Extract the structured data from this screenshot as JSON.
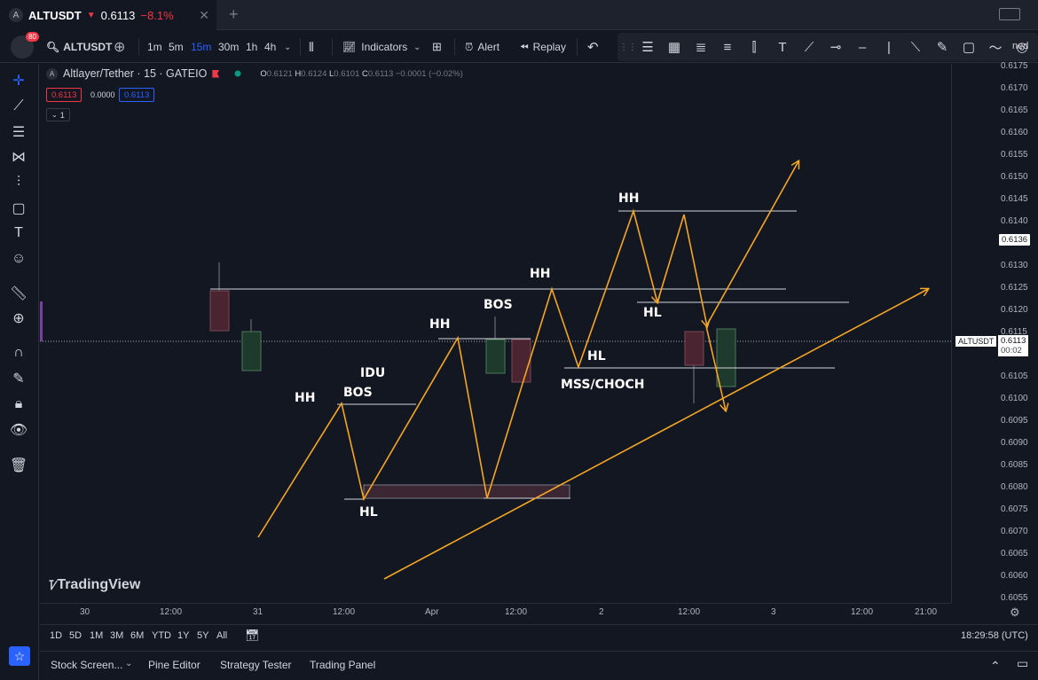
{
  "tab": {
    "avatar": "A",
    "symbol": "ALTUSDT",
    "arrow": "▼",
    "price": "0.6113",
    "change": "−8.1%",
    "close_icon": "close-icon"
  },
  "toolbar": {
    "avatar_badge": "80",
    "symbol": "ALTUSDT",
    "intervals": [
      "1m",
      "5m",
      "15m",
      "30m",
      "1h",
      "4h"
    ],
    "active_interval": "15m",
    "indicators_label": "Indicators",
    "alert_label": "Alert",
    "replay_label": "Replay",
    "truncated_label": "ned"
  },
  "legend": {
    "title": "Altlayer/Tether · 15 · GATEIO",
    "open_label": "O",
    "open": "0.6121",
    "high_label": "H",
    "high": "0.6124",
    "low_label": "L",
    "low": "0.6101",
    "close_label": "C",
    "close": "0.6113",
    "change": "−0.0001 (−0.02%)",
    "bid": "0.6113",
    "spread": "0.0000",
    "ask": "0.6113",
    "indicators_count": "1"
  },
  "price_axis": {
    "ticks": [
      "0.6175",
      "0.6170",
      "0.6165",
      "0.6160",
      "0.6155",
      "0.6150",
      "0.6145",
      "0.6140",
      "0.6135",
      "0.6130",
      "0.6125",
      "0.6120",
      "0.6115",
      "0.6110",
      "0.6105",
      "0.6100",
      "0.6095",
      "0.6090",
      "0.6085",
      "0.6080",
      "0.6075",
      "0.6070",
      "0.6065",
      "0.6060",
      "0.6055"
    ],
    "drawing_label": "0.6136",
    "symbol_label": "ALTUSDT",
    "current_price": "0.6113",
    "countdown": "00:02"
  },
  "time_axis": {
    "ticks": [
      "30",
      "12:00",
      "31",
      "12:00",
      "Apr",
      "12:00",
      "2",
      "12:00",
      "3",
      "12:00",
      "21:00"
    ]
  },
  "annotations": {
    "hh1": "HH",
    "bos1": "BOS",
    "idu": "IDU",
    "hl1": "HL",
    "hh2": "HH",
    "bos2": "BOS",
    "hh3": "HH",
    "hl2": "HL",
    "mss": "MSS/CHOCH",
    "hh4": "HH",
    "hl3": "HL"
  },
  "watermark": "TradingView",
  "range_buttons": [
    "1D",
    "5D",
    "1M",
    "3M",
    "6M",
    "YTD",
    "1Y",
    "5Y",
    "All"
  ],
  "clock": "18:29:58 (UTC)",
  "panels": [
    "Stock Screen...",
    "Pine Editor",
    "Strategy Tester",
    "Trading Panel"
  ],
  "colors": {
    "background": "#131722",
    "drawing_orange": "#f5a623",
    "bull_candle": "#1e3a2d",
    "bear_candle": "#4a2430",
    "accent_blue": "#2962ff",
    "down_red": "#f23645"
  }
}
